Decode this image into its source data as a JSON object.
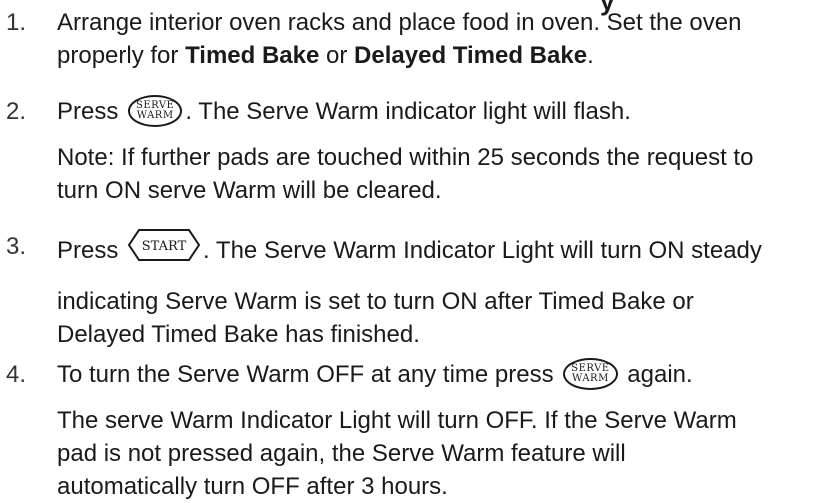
{
  "steps": [
    {
      "number": "1.",
      "line1_a": "Arrange interior oven racks and place food in oven. Set the oven",
      "line2_a": "properly for ",
      "bold1": "Timed Bake",
      "line2_b": " or ",
      "bold2": "Delayed Timed Bake",
      "line2_c": "."
    },
    {
      "number": "2.",
      "pre": "Press ",
      "post": ". The Serve Warm indicator light will flash.",
      "note_l1": "Note: If further pads are touched within 25 seconds the request to",
      "note_l2": "turn ON serve Warm will be cleared."
    },
    {
      "number": "3.",
      "pre": "Press ",
      "post": ". The Serve Warm Indicator Light will turn ON steady",
      "cont_l1": "indicating Serve Warm is set to turn ON after Timed Bake or",
      "cont_l2": "Delayed Timed Bake has finished."
    },
    {
      "number": "4.",
      "pre": "To turn the Serve Warm OFF at any time press ",
      "post": " again.",
      "cont_l1": "The serve Warm Indicator Light will turn OFF. If the Serve Warm",
      "cont_l2": "pad is not pressed again, the Serve Warm feature will",
      "cont_l3": "automatically turn OFF after 3 hours."
    }
  ],
  "pads": {
    "serve_warm_top": "SERVE",
    "serve_warm_bottom": "WARM",
    "start": "START"
  }
}
